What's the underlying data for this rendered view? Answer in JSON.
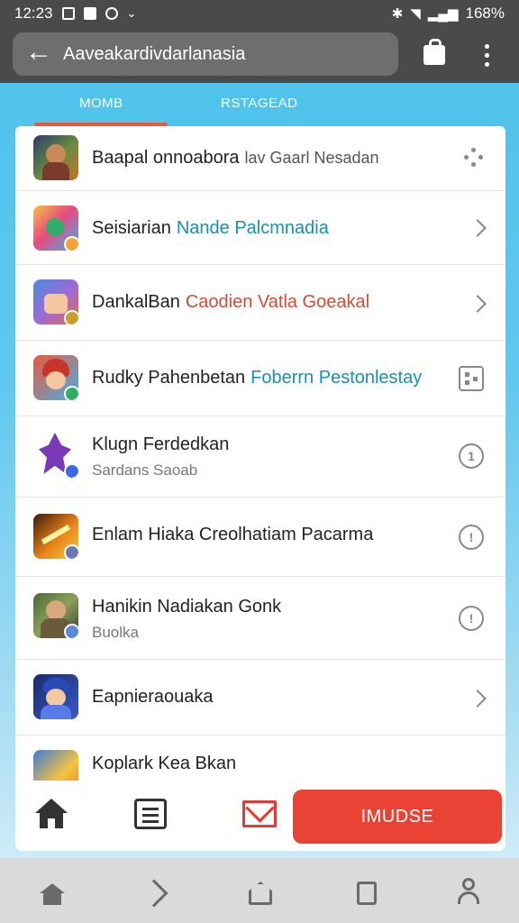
{
  "status_bar": {
    "time": "12:23",
    "battery": "168%",
    "chevron": "⌄"
  },
  "browser": {
    "back_glyph": "←",
    "url": "Aaveakardivdarlanasia"
  },
  "tabs": [
    {
      "label": "MOMB"
    },
    {
      "label": "RSTAGEAD"
    }
  ],
  "colors": {
    "teal_link": "#1a8fb0",
    "red_link": "#d84a35",
    "accent": "#ea4335"
  },
  "list": [
    {
      "title": "Baapal onnoabora",
      "highlight": "lav Gaarl Nesadan",
      "highlight_color": "#555555",
      "subtitle": "",
      "trailing": "dots-icon"
    },
    {
      "title": "Seisiarian",
      "highlight": "Nande Palcmnadia",
      "highlight_color": "#1a8fb0",
      "subtitle": "",
      "trailing": "chevron-right-icon"
    },
    {
      "title": "DankalBan",
      "highlight": "Caodien Vatla Goeakal",
      "highlight_color": "#d84a35",
      "subtitle": "",
      "trailing": "chevron-right-icon"
    },
    {
      "title": "Rudky Pahenbetan",
      "highlight": "Foberrn Pestonlestay",
      "highlight_color": "#1a8fb0",
      "subtitle": "",
      "trailing": "grid-square-icon"
    },
    {
      "title": "Klugn Ferdedkan",
      "highlight": "",
      "highlight_color": "#555555",
      "subtitle": "Sardans Saoab",
      "trailing": "info-circle-icon",
      "trailing_glyph": "1"
    },
    {
      "title": "Enlam Hiaka Creolhatiam Pacarma",
      "highlight": "",
      "highlight_color": "#555555",
      "subtitle": "",
      "trailing": "info-circle-icon",
      "trailing_glyph": "!"
    },
    {
      "title": "Hanikin Nadiakan Gonk",
      "highlight": "",
      "highlight_color": "#555555",
      "subtitle": "Buolka",
      "trailing": "info-circle-icon",
      "trailing_glyph": "!"
    },
    {
      "title": "Eapnieraouaka",
      "highlight": "",
      "highlight_color": "#555555",
      "subtitle": "",
      "trailing": "chevron-right-icon"
    },
    {
      "title": "Koplark Kea Bkan",
      "highlight": "",
      "highlight_color": "#555555",
      "subtitle": "",
      "trailing": ""
    }
  ],
  "bottom_bar": {
    "cta_label": "IMUDSE"
  }
}
